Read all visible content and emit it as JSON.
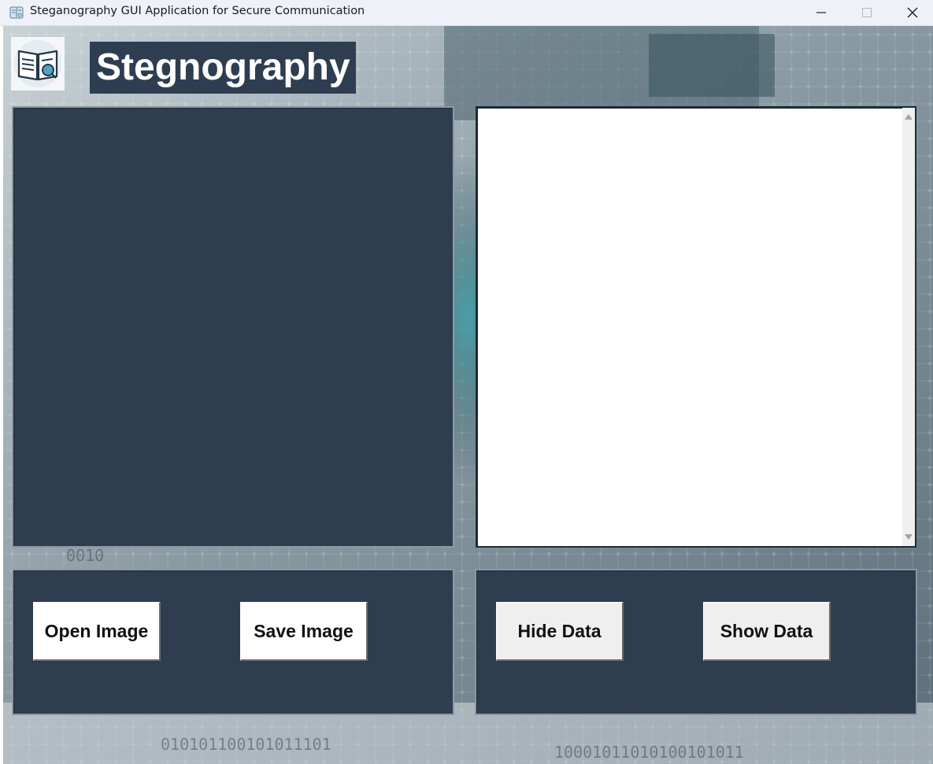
{
  "window": {
    "title": "Steganography GUI Application for Secure Communication",
    "app_icon": "notebook-icon",
    "controls": [
      "minimize-icon",
      "maximize-icon",
      "close-icon"
    ]
  },
  "header": {
    "logo_icon": "book-search-icon",
    "title": "Stegnography"
  },
  "image_panel": {
    "background": "#2e3e50"
  },
  "text_panel": {
    "value": "",
    "background": "#ffffff"
  },
  "buttons": {
    "open_image": "Open Image",
    "save_image": "Save Image",
    "hide_data": "Hide Data",
    "show_data": "Show Data"
  },
  "colors": {
    "panel": "#2e3e50",
    "titlebar": "#eef1f7"
  }
}
